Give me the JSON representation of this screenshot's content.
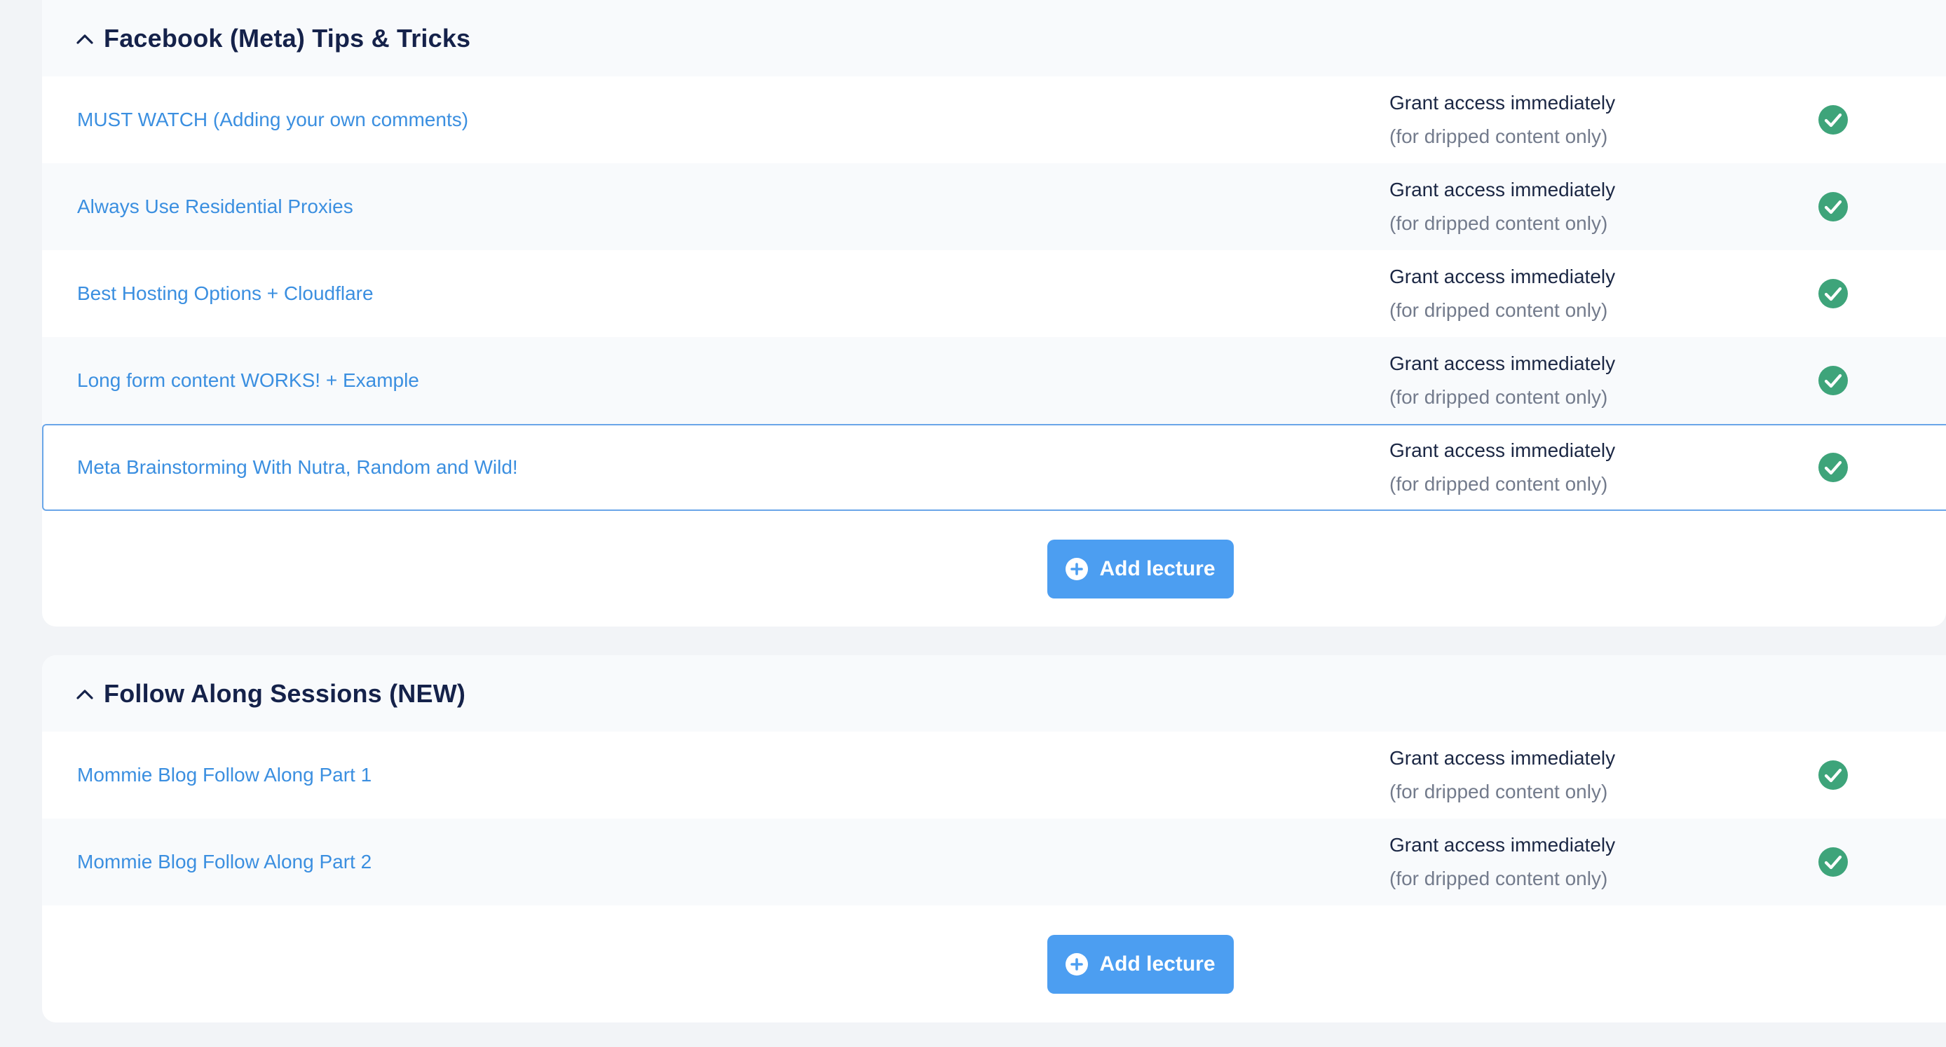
{
  "sections": [
    {
      "title": "Facebook (Meta) Tips & Tricks",
      "lectures": [
        {
          "title": "MUST WATCH (Adding your own comments)",
          "access": "Grant access immediately",
          "access_note": "(for dripped content only)"
        },
        {
          "title": "Always Use Residential Proxies",
          "access": "Grant access immediately",
          "access_note": "(for dripped content only)"
        },
        {
          "title": "Best Hosting Options + Cloudflare",
          "access": "Grant access immediately",
          "access_note": "(for dripped content only)"
        },
        {
          "title": "Long form content WORKS! + Example",
          "access": "Grant access immediately",
          "access_note": "(for dripped content only)"
        },
        {
          "title": "Meta Brainstorming With Nutra, Random and Wild!",
          "access": "Grant access immediately",
          "access_note": "(for dripped content only)"
        }
      ],
      "add_label": "Add lecture"
    },
    {
      "title": "Follow Along Sessions (NEW)",
      "lectures": [
        {
          "title": "Mommie Blog Follow Along Part 1",
          "access": "Grant access immediately",
          "access_note": "(for dripped content only)"
        },
        {
          "title": "Mommie Blog Follow Along Part 2",
          "access": "Grant access immediately",
          "access_note": "(for dripped content only)"
        }
      ],
      "add_label": "Add lecture"
    }
  ],
  "colors": {
    "link": "#3b8fe0",
    "title": "#15224a",
    "check": "#3ea47a",
    "button": "#4c9ef1",
    "selected_border": "#6aa6e8"
  },
  "icons": {
    "chevron": "chevron-up-icon",
    "check": "check-circle-icon",
    "add": "plus-circle-icon"
  }
}
